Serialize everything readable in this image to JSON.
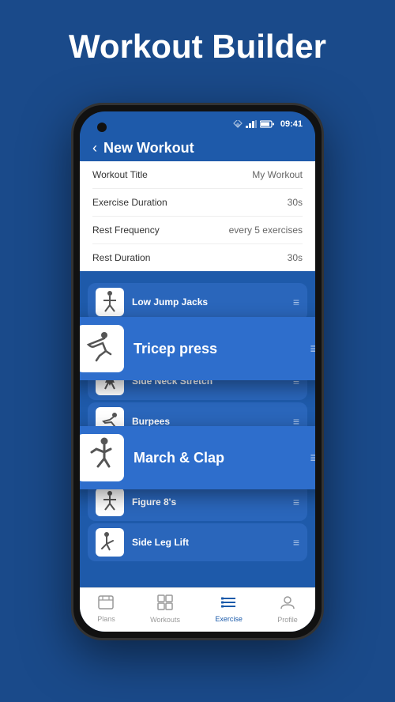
{
  "header": {
    "title": "Workout Builder"
  },
  "phone": {
    "status_time": "09:41",
    "nav_title": "New Workout",
    "back_label": "‹"
  },
  "settings": [
    {
      "label": "Workout Title",
      "value": "My Workout"
    },
    {
      "label": "Exercise Duration",
      "value": "30s"
    },
    {
      "label": "Rest Frequency",
      "value": "every 5 exercises"
    },
    {
      "label": "Rest Duration",
      "value": "30s"
    }
  ],
  "exercises": [
    {
      "name": "Low Jump Jacks",
      "active": false
    },
    {
      "name": "Tricep press",
      "active": true,
      "floating": true
    },
    {
      "name": "Side Neck Stretch",
      "active": false
    },
    {
      "name": "Burpees",
      "active": false
    },
    {
      "name": "March & Clap",
      "active": false,
      "floating_bottom": true
    },
    {
      "name": "Figure 8's",
      "active": false
    },
    {
      "name": "Side Leg Lift",
      "active": false
    }
  ],
  "bottom_nav": [
    {
      "label": "Plans",
      "active": false,
      "icon": "📋"
    },
    {
      "label": "Workouts",
      "active": false,
      "icon": "⊞"
    },
    {
      "label": "Exercise",
      "active": true,
      "icon": "☰"
    },
    {
      "label": "Profile",
      "active": false,
      "icon": "👤"
    }
  ],
  "colors": {
    "background": "#1a4a8a",
    "phone_bg": "#1e5aaa",
    "card_bg": "#2a66bb",
    "active_card": "#2e6ecc"
  }
}
